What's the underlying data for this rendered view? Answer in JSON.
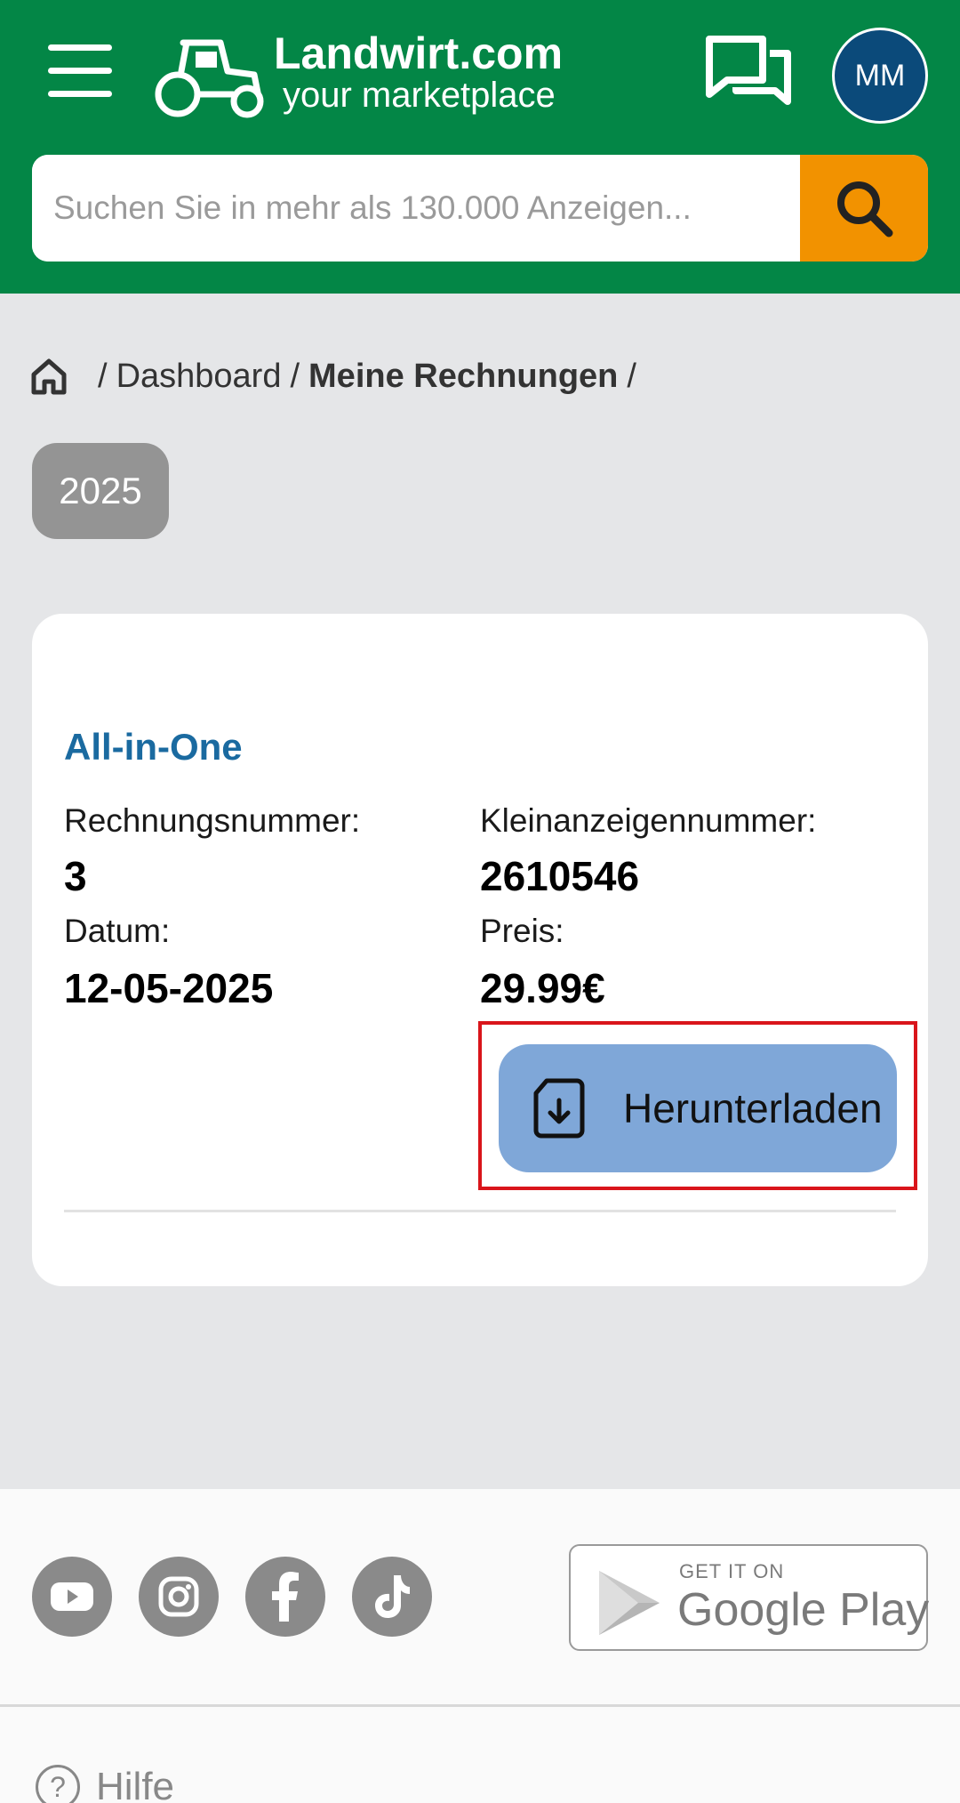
{
  "header": {
    "brand_name": "Landwirt.com",
    "brand_tagline": "your marketplace",
    "avatar_initials": "MM",
    "color": "#038646"
  },
  "search": {
    "placeholder": "Suchen Sie in mehr als 130.000 Anzeigen...",
    "button_color": "#f29200"
  },
  "breadcrumb": {
    "items": [
      "Dashboard",
      "Meine Rechnungen"
    ],
    "separator": "/"
  },
  "year_filter": {
    "label": "2025"
  },
  "invoice": {
    "product": "All-in-One",
    "invoice_number_label": "Rechnungsnummer:",
    "invoice_number": "3",
    "ad_number_label": "Kleinanzeigennummer:",
    "ad_number": "2610546",
    "date_label": "Datum:",
    "date": "12-05-2025",
    "price_label": "Preis:",
    "price": "29.99€",
    "download_label": "Herunterladen"
  },
  "footer": {
    "social_icons": [
      "youtube-icon",
      "instagram-icon",
      "facebook-icon",
      "tiktok-icon"
    ],
    "store_badge_small": "GET IT ON",
    "store_badge_big": "Google Play",
    "help_label": "Hilfe"
  }
}
